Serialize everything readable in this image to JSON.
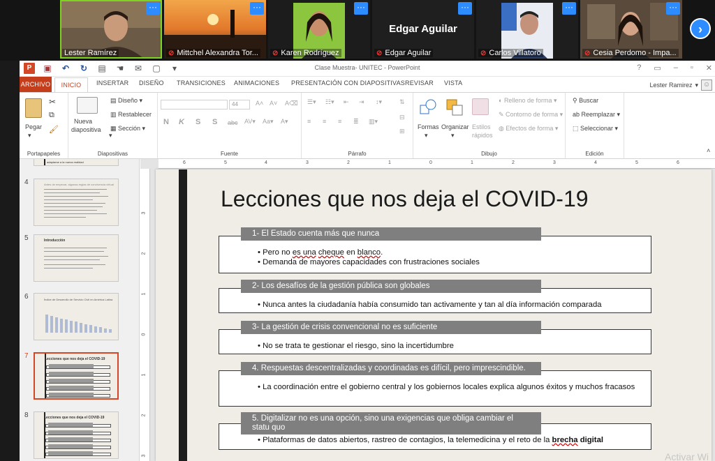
{
  "participants": [
    {
      "name": "Lester Ramírez",
      "muted": false,
      "active": true,
      "kind": "video"
    },
    {
      "name": "Mittchel Alexandra Tor...",
      "muted": true,
      "active": false,
      "kind": "video"
    },
    {
      "name": "Karen Rodríguez",
      "muted": true,
      "active": false,
      "kind": "video"
    },
    {
      "name": "Edgar Aguilar",
      "muted": true,
      "active": false,
      "kind": "name-only",
      "display_text": "Edgar Aguilar"
    },
    {
      "name": "Carlos Villatoro",
      "muted": true,
      "active": false,
      "kind": "video"
    },
    {
      "name": "Cesia Perdomo - Impa...",
      "muted": true,
      "active": false,
      "kind": "video"
    }
  ],
  "more_icon": "···",
  "next_page_icon": "chevron-right-icon",
  "ppt": {
    "window_title": "Clase Muestra- UNITEC - PowerPoint",
    "window_controls": [
      "?",
      "▭",
      "–",
      "▫",
      "✕"
    ],
    "tabs": [
      "ARCHIVO",
      "INICIO",
      "INSERTAR",
      "DISEÑO",
      "TRANSICIONES",
      "ANIMACIONES",
      "PRESENTACIÓN CON DIAPOSITIVAS",
      "REVISAR",
      "VISTA"
    ],
    "user_name": "Lester Ramirez",
    "ribbon": {
      "portapapeles": {
        "label": "Portapapeles",
        "pegar": "Pegar"
      },
      "diapositivas": {
        "label": "Diapositivas",
        "nueva": "Nueva",
        "diapositiva": "diapositiva",
        "diseno": "Diseño",
        "restablecer": "Restablecer",
        "seccion": "Sección"
      },
      "fuente": {
        "label": "Fuente",
        "font_size": "44"
      },
      "parrafo": {
        "label": "Párrafo"
      },
      "dibujo": {
        "label": "Dibujo",
        "formas": "Formas",
        "organizar": "Organizar",
        "estilos": "Estilos",
        "rapidos": "rápidos",
        "relleno": "Relleno de forma",
        "contorno": "Contorno de forma",
        "efectos": "Efectos de forma"
      },
      "edicion": {
        "label": "Edición",
        "buscar": "Buscar",
        "reemplazar": "Reemplazar",
        "seleccionar": "Seleccionar"
      }
    },
    "ruler_h": [
      "6",
      "5",
      "4",
      "3",
      "2",
      "1",
      "0",
      "1",
      "2",
      "3",
      "4",
      "5",
      "6"
    ],
    "ruler_v": [
      "3",
      "2",
      "1",
      "0",
      "1",
      "2",
      "3"
    ]
  },
  "thumbnails": [
    {
      "num": "",
      "kind": "partial",
      "text": "adaptarse a la nueva realidad"
    },
    {
      "num": "4",
      "kind": "text",
      "title": "Antes de empezar, algunas reglas de convivencia virtual"
    },
    {
      "num": "5",
      "kind": "text",
      "title": "Introducción"
    },
    {
      "num": "6",
      "kind": "chart",
      "title": "Índice de Desarrollo de Servicio Civil en América Latina"
    },
    {
      "num": "7",
      "kind": "lessons",
      "title": "Lecciones que nos deja el COVID-19",
      "selected": true
    },
    {
      "num": "8",
      "kind": "lessons",
      "title": "Lecciones que nos deja el COVID-19"
    }
  ],
  "slide": {
    "title": "Lecciones que nos deja el COVID-19",
    "lessons": [
      {
        "heading": "1- El Estado cuenta más que nunca",
        "bullets": [
          "Pero no es una cheque en blanco.",
          "Demanda de mayores capacidades con frustraciones sociales"
        ]
      },
      {
        "heading": "2- Los desafíos de la gestión pública son globales",
        "bullets": [
          "Nunca antes la ciudadanía había consumido tan activamente y tan al día información comparada"
        ]
      },
      {
        "heading": "3- La gestión de crisis convencional no es suficiente",
        "bullets": [
          "No se trata te gestionar el riesgo, sino la incertidumbre"
        ]
      },
      {
        "heading": "4. Respuestas descentralizadas y coordinadas es difícil, pero imprescindible.",
        "bullets": [
          "La coordinación entre el gobierno central y los gobiernos locales explica algunos éxitos y muchos fracasos"
        ]
      },
      {
        "heading": "5. Digitalizar no es una opción, sino una exigencias que obliga cambiar el statu quo",
        "bullets": [
          "Plataformas de datos abiertos, rastreo de contagios, la telemedicina y el reto de la brecha digital"
        ]
      }
    ],
    "watermark": "Activar Wi"
  }
}
